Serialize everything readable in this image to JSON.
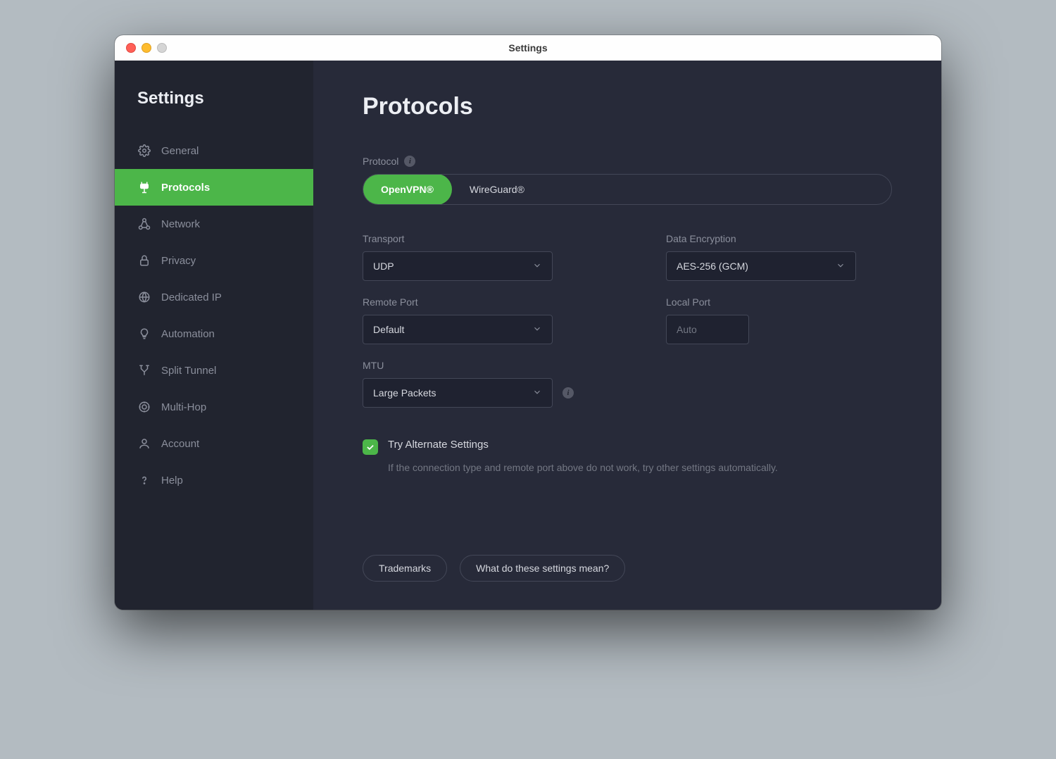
{
  "window_title": "Settings",
  "sidebar": {
    "title": "Settings",
    "items": [
      {
        "label": "General",
        "icon": "gear-icon"
      },
      {
        "label": "Protocols",
        "icon": "protocol-icon"
      },
      {
        "label": "Network",
        "icon": "network-icon"
      },
      {
        "label": "Privacy",
        "icon": "lock-icon"
      },
      {
        "label": "Dedicated IP",
        "icon": "dedicated-ip-icon"
      },
      {
        "label": "Automation",
        "icon": "bulb-icon"
      },
      {
        "label": "Split Tunnel",
        "icon": "split-icon"
      },
      {
        "label": "Multi-Hop",
        "icon": "multihop-icon"
      },
      {
        "label": "Account",
        "icon": "account-icon"
      },
      {
        "label": "Help",
        "icon": "help-icon"
      }
    ],
    "active_index": 1
  },
  "main": {
    "title": "Protocols",
    "protocol": {
      "label": "Protocol",
      "options": [
        "OpenVPN®",
        "WireGuard®"
      ],
      "selected_index": 0
    },
    "transport": {
      "label": "Transport",
      "value": "UDP"
    },
    "encryption": {
      "label": "Data Encryption",
      "value": "AES-256 (GCM)"
    },
    "remote_port": {
      "label": "Remote Port",
      "value": "Default"
    },
    "local_port": {
      "label": "Local Port",
      "placeholder": "Auto",
      "value": ""
    },
    "mtu": {
      "label": "MTU",
      "value": "Large Packets"
    },
    "alternate": {
      "checked": true,
      "label": "Try Alternate Settings",
      "description": "If the connection type and remote port above do not work, try other settings automatically."
    },
    "footer": {
      "trademarks": "Trademarks",
      "help": "What do these settings mean?"
    }
  }
}
